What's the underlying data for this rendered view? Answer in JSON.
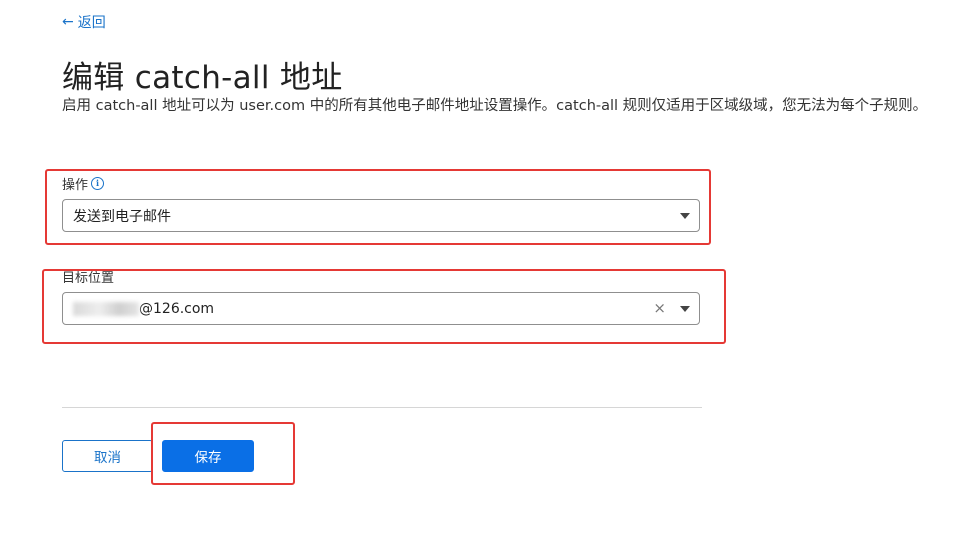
{
  "back": {
    "label": "返回",
    "arrow": "←"
  },
  "title": "编辑 catch-all 地址",
  "description": "启用 catch-all 地址可以为 user.com 中的所有其他电子邮件地址设置操作。catch-all 规则仅适用于区域级域，您无法为每个子规则。",
  "action_field": {
    "label": "操作",
    "info_icon_glyph": "i",
    "selected": "发送到电子邮件"
  },
  "destination_field": {
    "label": "目标位置",
    "value_visible": "@126.com",
    "clear_glyph": "×"
  },
  "buttons": {
    "cancel": "取消",
    "save": "保存"
  },
  "colors": {
    "accent": "#1a73c9",
    "primary_button": "#0a6fe6",
    "highlight_box": "#e53935"
  }
}
